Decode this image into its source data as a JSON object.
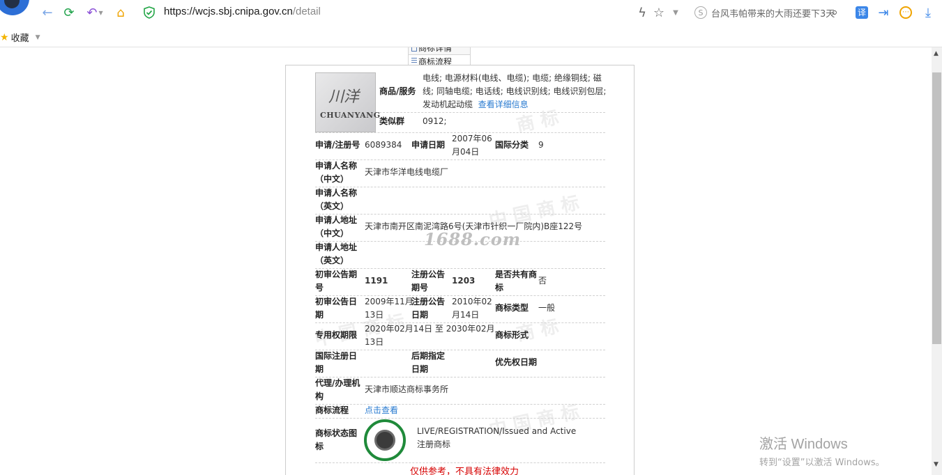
{
  "browser": {
    "url_domain": "https://wcjs.sbj.cnipa.gov.cn",
    "url_path": "/detail",
    "search_text": "台风韦帕带来的大雨还要下3天",
    "bookmarks_label": "收藏"
  },
  "tabs": [
    {
      "label": "商标详情"
    },
    {
      "label": "商标流程"
    }
  ],
  "logo": {
    "cn": "川洋",
    "en": "CHUANYANG"
  },
  "detail": {
    "goods_services_label": "商品/服务",
    "goods_services_line1": "电线; 电源材料(电线、电缆); 电缆; 绝缘铜线; 磁",
    "goods_services_line2": "线; 同轴电缆; 电话线; 电线识别线; 电线识别包层;",
    "goods_services_line3": "发动机起动缆",
    "view_detail_link": "查看详细信息",
    "similar_group_label": "类似群",
    "similar_group_value": "0912;",
    "reg_no_label": "申请/注册号",
    "reg_no_value": "6089384",
    "apply_date_label": "申请日期",
    "apply_date_line1": "2007年06",
    "apply_date_line2": "月04日",
    "intl_class_label": "国际分类",
    "intl_class_value": "9",
    "applicant_cn_label1": "申请人名称",
    "applicant_cn_label2": "（中文）",
    "applicant_cn_value": "天津市华洋电线电缆厂",
    "applicant_en_label1": "申请人名称",
    "applicant_en_label2": "（英文）",
    "address_cn_label1": "申请人地址",
    "address_cn_label2": "（中文）",
    "address_cn_value": "天津市南开区南泥湾路6号(天津市针织一厂院内)B座122号",
    "address_en_label1": "申请人地址",
    "address_en_label2": "（英文）",
    "prelim_issue_label1": "初审公告期",
    "prelim_issue_label2": "号",
    "prelim_issue_value": "1191",
    "reg_issue_label1": "注册公告",
    "reg_issue_label2": "期号",
    "reg_issue_value": "1203",
    "shared_label1": "是否共有商",
    "shared_label2": "标",
    "shared_value": "否",
    "prelim_date_label1": "初审公告日",
    "prelim_date_label2": "期",
    "prelim_date_line1": "2009年11月",
    "prelim_date_line2": "13日",
    "reg_date_label1": "注册公告",
    "reg_date_label2": "日期",
    "reg_date_line1": "2010年02",
    "reg_date_line2": "月14日",
    "mark_type_label": "商标类型",
    "mark_type_value": "一般",
    "term_label": "专用权期限",
    "term_line1": "2020年02月14日 至 2030年02月",
    "term_line2": "13日",
    "mark_form_label": "商标形式",
    "intl_reg_date_label1": "国际注册日",
    "intl_reg_date_label2": "期",
    "later_designation_label1": "后期指定",
    "later_designation_label2": "日期",
    "priority_date_label": "优先权日期",
    "agent_label1": "代理/办理机",
    "agent_label2": "构",
    "agent_value": "天津市顺达商标事务所",
    "process_label": "商标流程",
    "process_link": "点击查看",
    "status_label1": "商标状态图",
    "status_label2": "标",
    "status_en": "LIVE/REGISTRATION/Issued and Active",
    "status_cn": "注册商标",
    "disclaimer": "仅供参考，不具有法律效力"
  },
  "watermark_text": "1688.com",
  "activation": {
    "title": "激活 Windows",
    "subtitle": "转到“设置”以激活 Windows。"
  }
}
